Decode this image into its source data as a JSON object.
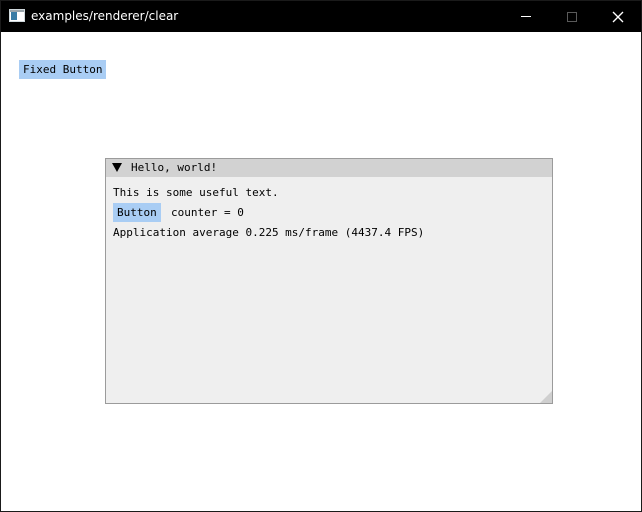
{
  "window": {
    "title": "examples/renderer/clear",
    "icon": "app-window-icon",
    "controls": {
      "minimize_icon": "minimize-icon",
      "maximize_icon": "maximize-icon",
      "close_icon": "close-icon",
      "close_glyph": "✕"
    }
  },
  "client": {
    "fixed_button_label": "Fixed Button"
  },
  "imgui_window": {
    "title": "Hello, world!",
    "collapse_icon": "collapse-arrow-icon",
    "text": "This is some useful text.",
    "button_label": "Button",
    "counter_text": "counter = 0",
    "fps_text": "Application average 0.225 ms/frame (4437.4 FPS)"
  },
  "colors": {
    "titlebar_bg": "#000000",
    "button_bg": "#a9cdf4",
    "inner_window_bg": "#efefef",
    "inner_titlebar_bg": "#d2d2d2"
  }
}
